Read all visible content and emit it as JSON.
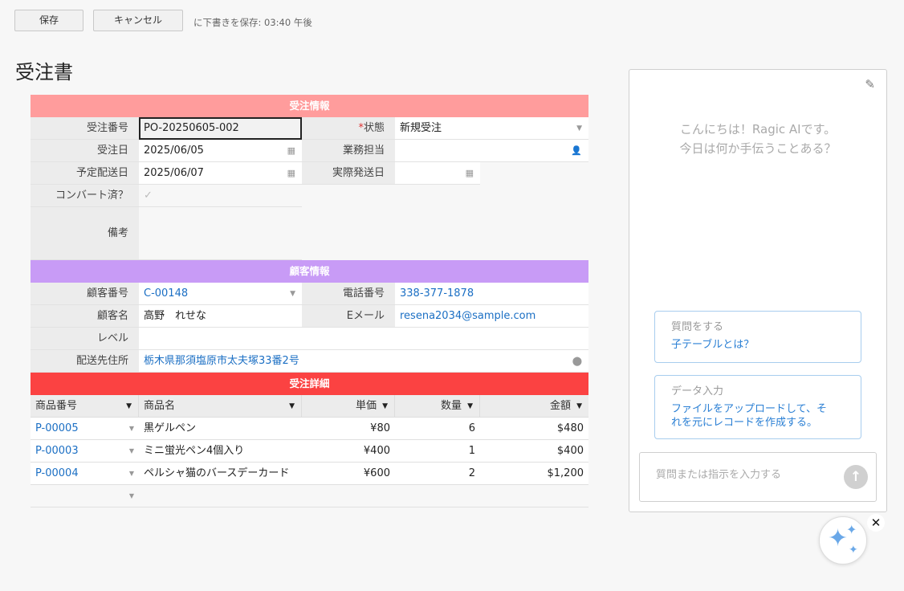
{
  "toolbar": {
    "save_label": "保存",
    "cancel_label": "キャンセル",
    "draft_status": "に下書きを保存: 03:40 午後"
  },
  "page_title": "受注書",
  "order_section": {
    "header": "受注情報",
    "order_no_label": "受注番号",
    "order_no": "PO-20250605-002",
    "status_required_mark": "*",
    "status_label": "状態",
    "status": "新規受注",
    "order_date_label": "受注日",
    "order_date": "2025/06/05",
    "sales_rep_label": "業務担当",
    "sales_rep": "",
    "ship_plan_label": "予定配送日",
    "ship_plan": "2025/06/07",
    "ship_actual_label": "実際発送日",
    "ship_actual": "",
    "converted_label": "コンバート済？",
    "memo_label": "備考",
    "memo": ""
  },
  "customer_section": {
    "header": "顧客情報",
    "cust_no_label": "顧客番号",
    "cust_no": "C-00148",
    "phone_label": "電話番号",
    "phone": "338-377-1878",
    "cust_name_label": "顧客名",
    "cust_name": "高野　れせな",
    "email_label": "Eメール",
    "email": "resena2034@sample.com",
    "level_label": "レベル",
    "level": "",
    "address_label": "配送先住所",
    "address": "栃木県那須塩原市太夫塚33番2号"
  },
  "detail_section": {
    "header": "受注詳細",
    "columns": [
      "商品番号",
      "商品名",
      "単価",
      "数量",
      "金額"
    ],
    "rows": [
      {
        "code": "P-00005",
        "name": "黒ゲルペン",
        "price": "¥80",
        "qty": "6",
        "amount": "$480"
      },
      {
        "code": "P-00003",
        "name": "ミニ蛍光ペン4個入り",
        "price": "¥400",
        "qty": "1",
        "amount": "$400"
      },
      {
        "code": "P-00004",
        "name": "ペルシャ猫のバースデーカード",
        "price": "¥600",
        "qty": "2",
        "amount": "$1,200"
      }
    ]
  },
  "ai_panel": {
    "greeting_line1": "こんにちは！Ragic AIです。",
    "greeting_line2": "今日は何か手伝うことある？",
    "suggestion1_kind": "質問をする",
    "suggestion1_text": "子テーブルとは？",
    "suggestion2_kind": "データ入力",
    "suggestion2_text_line1": "ファイルをアップロードして、そ",
    "suggestion2_text_line2": "れを元にレコードを作成する。",
    "input_placeholder": "質問または指示を入力する"
  },
  "icons": {
    "edit": "edit-icon",
    "send": "send-arrow-up-icon",
    "ai_fab": "sparkles-icon",
    "close": "close-icon"
  }
}
